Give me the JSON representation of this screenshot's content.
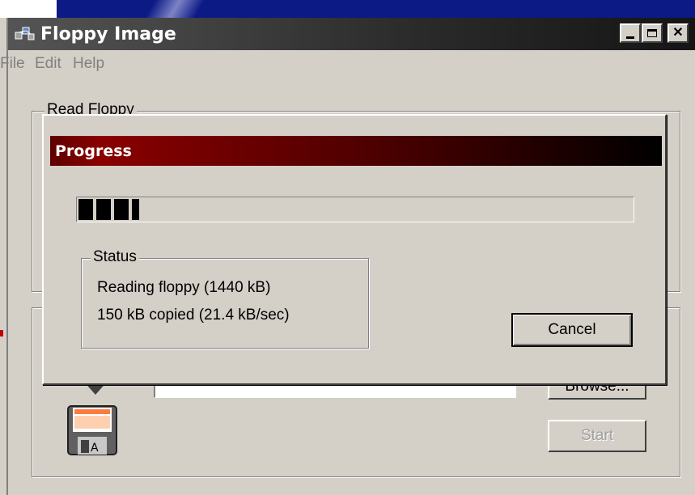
{
  "window": {
    "title": "Floppy Image",
    "controls": [
      "minimize",
      "maximize",
      "close"
    ]
  },
  "menu": [
    "File",
    "Edit",
    "Help"
  ],
  "read_group": {
    "label": "Read Floppy"
  },
  "write_group": {
    "browse_label": "Browse...",
    "start_label": "Start"
  },
  "dialog": {
    "title": "Progress",
    "progress_fraction": 0.11,
    "status_group_label": "Status",
    "status_line1": "Reading floppy (1440 kB)",
    "status_line2": "150 kB copied (21.4 kB/sec)",
    "cancel_label": "Cancel"
  },
  "colors": {
    "dialog_title_start": "#8a0000",
    "dialog_title_end": "#000000",
    "window_face": "#d4d0c8"
  }
}
